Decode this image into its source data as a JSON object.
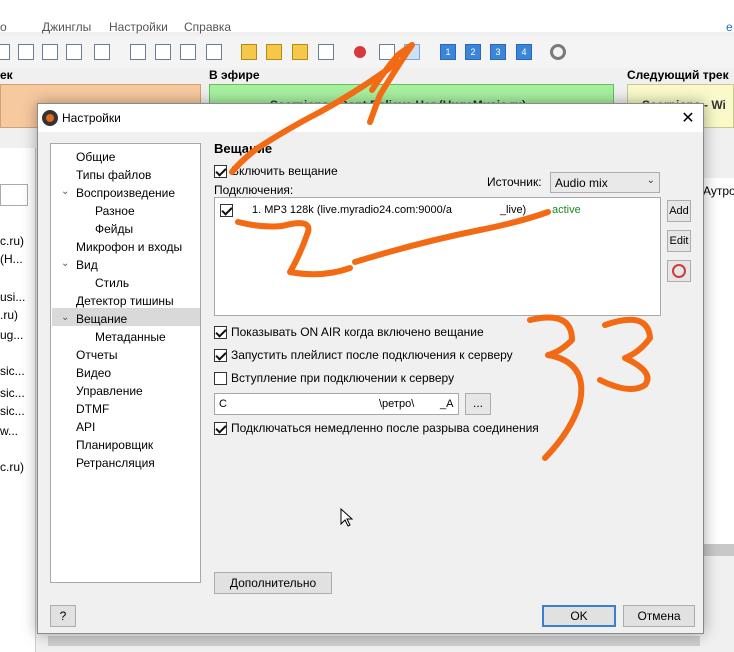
{
  "menu": {
    "items": [
      "Джинглы",
      "Настройки",
      "Справка"
    ],
    "edge_left": "о",
    "edge_right": "e"
  },
  "panels": {
    "left_label": "ек",
    "onair_label": "В эфире",
    "onair_text": "Scorpions - Dont Believe Her (HugeMusic.ru)",
    "next_label": "Следующий трек",
    "next_text": "Scorpions - Wi"
  },
  "left_list": [
    "c.ru)",
    "(H...",
    "usi...",
    ".ru)",
    "ug...",
    "sic...",
    "sic...",
    "sic...",
    "w...",
    "c.ru)"
  ],
  "right_col_text": "Аутро",
  "dialog": {
    "title": "Настройки",
    "close_glyph": "✕",
    "tree": [
      {
        "label": "Общие",
        "level": 0
      },
      {
        "label": "Типы файлов",
        "level": 0
      },
      {
        "label": "Воспроизведение",
        "level": 0,
        "expanded": true
      },
      {
        "label": "Разное",
        "level": 1
      },
      {
        "label": "Фейды",
        "level": 1
      },
      {
        "label": "Микрофон и входы",
        "level": 0
      },
      {
        "label": "Вид",
        "level": 0,
        "expanded": true
      },
      {
        "label": "Стиль",
        "level": 1
      },
      {
        "label": "Детектор тишины",
        "level": 0
      },
      {
        "label": "Вещание",
        "level": 0,
        "expanded": true,
        "selected": true
      },
      {
        "label": "Метаданные",
        "level": 1
      },
      {
        "label": "Отчеты",
        "level": 0
      },
      {
        "label": "Видео",
        "level": 0
      },
      {
        "label": "Управление",
        "level": 0
      },
      {
        "label": "DTMF",
        "level": 0
      },
      {
        "label": "API",
        "level": 0
      },
      {
        "label": "Планировщик",
        "level": 0
      },
      {
        "label": "Ретрансляция",
        "level": 0
      }
    ],
    "section_title": "Вещание",
    "enable_label": "Включить вещание",
    "enable_checked": true,
    "connections_label": "Подключения:",
    "source_label": "Источник:",
    "source_value": "Audio mix",
    "connections": [
      {
        "text": "1. MP3 128k (live.myradio24.com:9000/a",
        "text_end": "_live)",
        "status": "active",
        "checked": true
      }
    ],
    "side_buttons": {
      "add": "Add",
      "edit": "Edit",
      "delete": "Delete"
    },
    "options": [
      {
        "label": "Показывать ON AIR когда включено вещание",
        "checked": true
      },
      {
        "label": "Запустить плейлист после подключения к серверу",
        "checked": true
      },
      {
        "label": "Вступление при подключении к серверу",
        "checked": false
      }
    ],
    "intro_path": {
      "start": "C",
      "middle": "\\ретро\\",
      "end": "_A"
    },
    "browse_label": "...",
    "reconnect_label": "Подключаться немедленно после разрыва соединения",
    "reconnect_checked": true,
    "advanced_label": "Дополнительно",
    "help_label": "?",
    "ok_label": "OK",
    "cancel_label": "Отмена"
  },
  "annotations": [
    "1",
    "2",
    "3",
    "3"
  ],
  "colors": {
    "annotation": "#f36a14",
    "onair_panel": "#a7f0a0",
    "prev_panel": "#f7c99f",
    "next_panel": "#f9f9c9",
    "status_active": "#1a8a1a"
  }
}
